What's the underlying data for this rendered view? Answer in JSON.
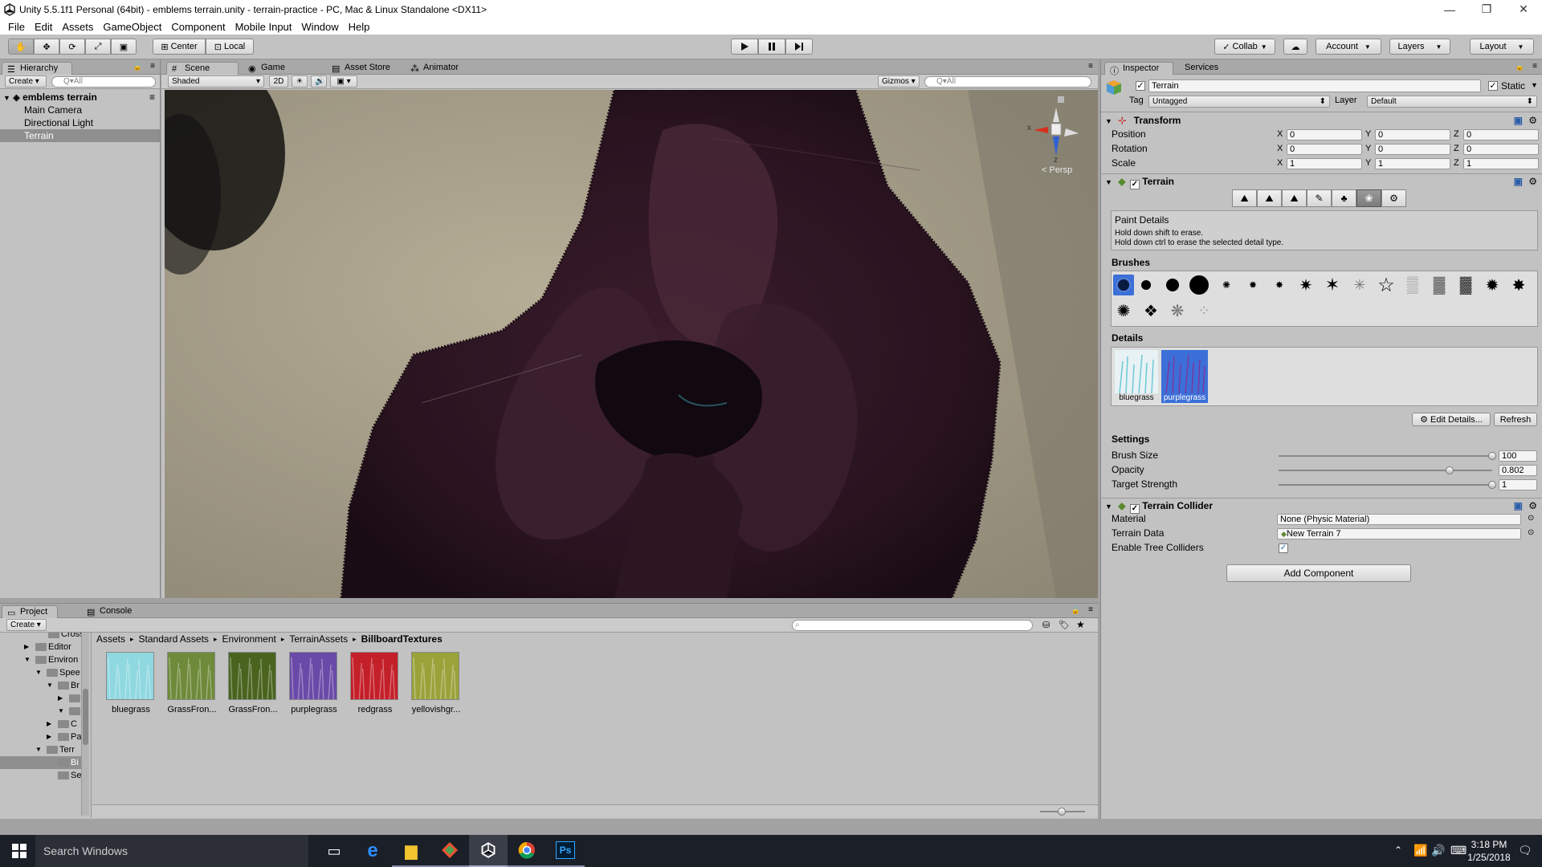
{
  "window": {
    "title": "Unity 5.5.1f1 Personal (64bit) - emblems terrain.unity - terrain-practice - PC, Mac & Linux Standalone <DX11>"
  },
  "menu": [
    "File",
    "Edit",
    "Assets",
    "GameObject",
    "Component",
    "Mobile Input",
    "Window",
    "Help"
  ],
  "toolbar": {
    "center": "Center",
    "local": "Local",
    "collab": "Collab",
    "account": "Account",
    "layers": "Layers",
    "layout": "Layout"
  },
  "hierarchy": {
    "tab": "Hierarchy",
    "create": "Create",
    "search": "Q▾All",
    "scene": "emblems terrain",
    "items": [
      "Main Camera",
      "Directional Light",
      "Terrain"
    ]
  },
  "scene_view": {
    "tabs": [
      "Scene",
      "Game",
      "Asset Store",
      "Animator"
    ],
    "shading": "Shaded",
    "mode2d": "2D",
    "gizmos": "Gizmos",
    "search": "Q▾All",
    "persp": "< Persp",
    "axis_x": "x",
    "axis_z": "z"
  },
  "inspector": {
    "tabs": [
      "Inspector",
      "Services"
    ],
    "object_name": "Terrain",
    "static": "Static",
    "tag_label": "Tag",
    "tag_value": "Untagged",
    "layer_label": "Layer",
    "layer_value": "Default",
    "transform": {
      "title": "Transform",
      "rows": [
        {
          "label": "Position",
          "x": "0",
          "y": "0",
          "z": "0"
        },
        {
          "label": "Rotation",
          "x": "0",
          "y": "0",
          "z": "0"
        },
        {
          "label": "Scale",
          "x": "1",
          "y": "1",
          "z": "1"
        }
      ],
      "axis_x": "X",
      "axis_y": "Y",
      "axis_z": "Z"
    },
    "terrain": {
      "title": "Terrain",
      "paint_title": "Paint Details",
      "paint_hint1": "Hold down shift to erase.",
      "paint_hint2": "Hold down ctrl to erase the selected detail type.",
      "brushes_label": "Brushes",
      "details_label": "Details",
      "details": [
        "bluegrass",
        "purplegrass"
      ],
      "edit_details": "Edit Details...",
      "refresh": "Refresh",
      "settings_label": "Settings",
      "settings": [
        {
          "label": "Brush Size",
          "value": "100",
          "fraction": 1.0
        },
        {
          "label": "Opacity",
          "value": "0.802",
          "fraction": 0.802
        },
        {
          "label": "Target Strength",
          "value": "1",
          "fraction": 1.0
        }
      ]
    },
    "collider": {
      "title": "Terrain Collider",
      "material_label": "Material",
      "material_value": "None (Physic Material)",
      "data_label": "Terrain Data",
      "data_value": "New Terrain 7",
      "trees_label": "Enable Tree Colliders"
    },
    "add_component": "Add Component"
  },
  "project": {
    "tabs": [
      "Project",
      "Console"
    ],
    "create": "Create",
    "tree": [
      "CrossP",
      "Editor",
      "Environ",
      "Spee",
      "Br",
      "",
      "",
      "C",
      "Pa",
      "Terr",
      "Bi",
      "Se"
    ],
    "breadcrumb": [
      "Assets",
      "Standard Assets",
      "Environment",
      "TerrainAssets",
      "BillboardTextures"
    ],
    "assets": [
      {
        "name": "bluegrass",
        "color": "#8fd8e0"
      },
      {
        "name": "GrassFron...",
        "color": "#6e8a3a"
      },
      {
        "name": "GrassFron...",
        "color": "#4a6420"
      },
      {
        "name": "purplegrass",
        "color": "#6a4aa8"
      },
      {
        "name": "redgrass",
        "color": "#c4202a"
      },
      {
        "name": "yellovishgr...",
        "color": "#9aa23a"
      }
    ]
  },
  "taskbar": {
    "search": "Search Windows",
    "time": "3:18 PM",
    "date": "1/25/2018"
  }
}
